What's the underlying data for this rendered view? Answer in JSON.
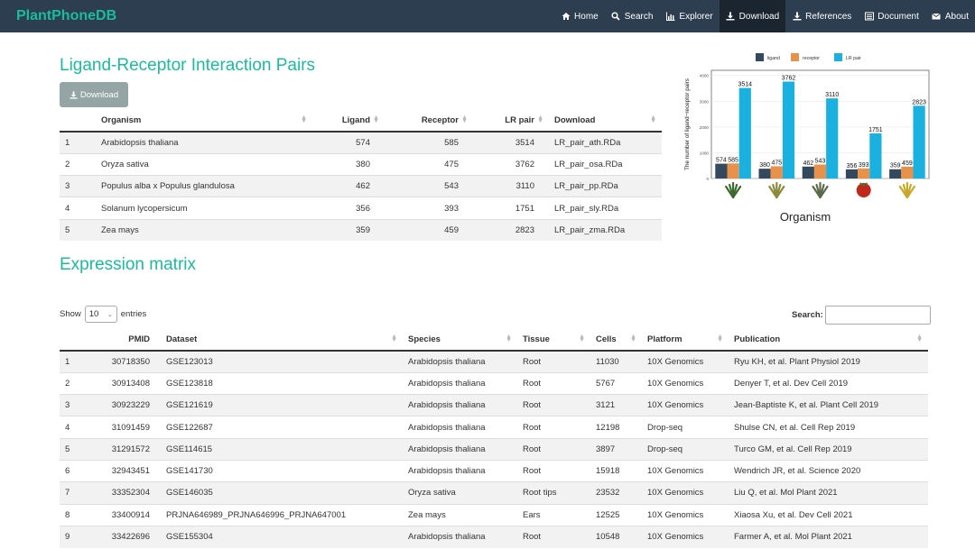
{
  "navbar": {
    "brand": "PlantPhoneDB",
    "items": [
      {
        "label": "Home",
        "icon": "home-icon"
      },
      {
        "label": "Search",
        "icon": "search-icon"
      },
      {
        "label": "Explorer",
        "icon": "chart-icon"
      },
      {
        "label": "Download",
        "icon": "download-icon",
        "active": true
      },
      {
        "label": "References",
        "icon": "download-icon"
      },
      {
        "label": "Document",
        "icon": "list-icon"
      },
      {
        "label": "About",
        "icon": "envelope-icon"
      }
    ]
  },
  "lr_section": {
    "title": "Ligand-Receptor Interaction Pairs",
    "download_label": "Download",
    "headers": [
      "Organism",
      "Ligand",
      "Receptor",
      "LR pair",
      "Download"
    ],
    "rows": [
      [
        "1",
        "Arabidopsis thaliana",
        "574",
        "585",
        "3514",
        "LR_pair_ath.RDa"
      ],
      [
        "2",
        "Oryza sativa",
        "380",
        "475",
        "3762",
        "LR_pair_osa.RDa"
      ],
      [
        "3",
        "Populus alba x Populus glandulosa",
        "462",
        "543",
        "3110",
        "LR_pair_pp.RDa"
      ],
      [
        "4",
        "Solanum lycopersicum",
        "356",
        "393",
        "1751",
        "LR_pair_sly.RDa"
      ],
      [
        "5",
        "Zea mays",
        "359",
        "459",
        "2823",
        "LR_pair_zma.RDa"
      ]
    ]
  },
  "chart_data": {
    "type": "bar",
    "categories": [
      "Arabidopsis thaliana",
      "Oryza sativa",
      "Populus alba x Populus glandulosa",
      "Solanum lycopersicum",
      "Zea mays"
    ],
    "series": [
      {
        "name": "ligand",
        "values": [
          574,
          380,
          462,
          356,
          359
        ],
        "color": "#34495e"
      },
      {
        "name": "receptor",
        "values": [
          585,
          475,
          543,
          393,
          459
        ],
        "color": "#e8914a"
      },
      {
        "name": "LR pair",
        "values": [
          3514,
          3762,
          3110,
          1751,
          2823
        ],
        "color": "#1ab0e0"
      }
    ],
    "xlabel": "Organism",
    "ylabel": "The number of ligand−receptor pairs",
    "ylim": [
      0,
      4200
    ],
    "yticks": [
      "0",
      "1000",
      "2000",
      "3000",
      "4000"
    ],
    "legend": "top",
    "grid": true
  },
  "expr_section": {
    "title": "Expression matrix",
    "show_label": "Show",
    "entries_value": "10",
    "entries_label": "entries",
    "search_label": "Search:",
    "headers": [
      "PMID",
      "Dataset",
      "Species",
      "Tissue",
      "Cells",
      "Platform",
      "Publication"
    ],
    "rows": [
      [
        "1",
        "30718350",
        "GSE123013",
        "Arabidopsis thaliana",
        "Root",
        "11030",
        "10X Genomics",
        "Ryu KH, et al. Plant Physiol 2019"
      ],
      [
        "2",
        "30913408",
        "GSE123818",
        "Arabidopsis thaliana",
        "Root",
        "5767",
        "10X Genomics",
        "Denyer T, et al. Dev Cell 2019"
      ],
      [
        "3",
        "30923229",
        "GSE121619",
        "Arabidopsis thaliana",
        "Root",
        "3121",
        "10X Genomics",
        "Jean-Baptiste K, et al. Plant Cell 2019"
      ],
      [
        "4",
        "31091459",
        "GSE122687",
        "Arabidopsis thaliana",
        "Root",
        "12198",
        "Drop-seq",
        "Shulse CN, et al. Cell Rep 2019"
      ],
      [
        "5",
        "31291572",
        "GSE114615",
        "Arabidopsis thaliana",
        "Root",
        "3897",
        "Drop-seq",
        "Turco GM, et al. Cell Rep 2019"
      ],
      [
        "6",
        "32943451",
        "GSE141730",
        "Arabidopsis thaliana",
        "Root",
        "15918",
        "10X Genomics",
        "Wendrich JR, et al. Science 2020"
      ],
      [
        "7",
        "33352304",
        "GSE146035",
        "Oryza sativa",
        "Root tips",
        "23532",
        "10X Genomics",
        "Liu Q, et al. Mol Plant 2021"
      ],
      [
        "8",
        "33400914",
        "PRJNA646989_PRJNA646996_PRJNA647001",
        "Zea mays",
        "Ears",
        "12525",
        "10X Genomics",
        "Xiaosa Xu, et al. Dev Cell 2021"
      ],
      [
        "9",
        "33422696",
        "GSE155304",
        "Arabidopsis thaliana",
        "Root",
        "10548",
        "10X Genomics",
        "Farmer A, et al. Mol Plant 2021"
      ]
    ]
  }
}
